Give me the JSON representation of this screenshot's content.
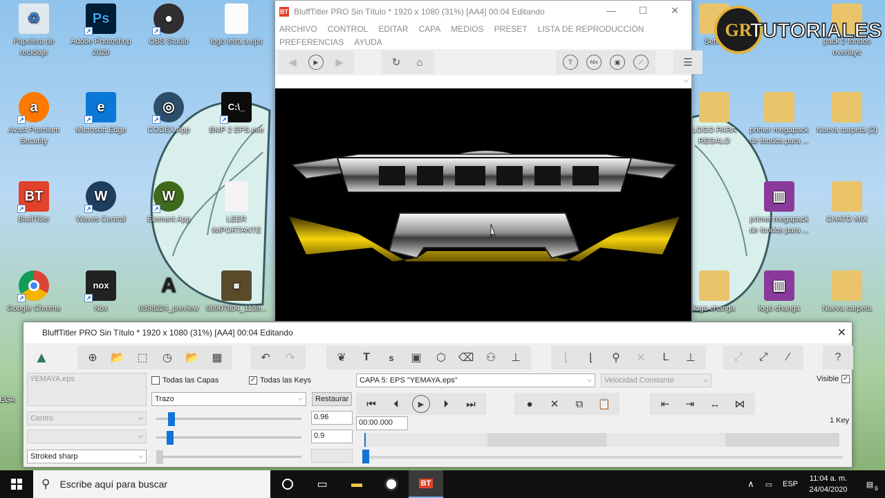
{
  "desktop": {
    "icons": [
      {
        "label": "Papelera de reciclaje",
        "x": 1
      },
      {
        "label": "Adobe Photoshop 2020"
      },
      {
        "label": "OBS Studio"
      },
      {
        "label": "logo letra a.eps"
      },
      {
        "label": "Avast Premium Security"
      },
      {
        "label": "Microsoft Edge"
      },
      {
        "label": "CODEX App"
      },
      {
        "label": "BMP 2 EPS.exe"
      },
      {
        "label": "BluffTitler"
      },
      {
        "label": "Waves Central"
      },
      {
        "label": "Element App"
      },
      {
        "label": "LEER IMPORTANTE"
      },
      {
        "label": "Google Chrome"
      },
      {
        "label": "Nox"
      },
      {
        "label": "6398224_preview"
      },
      {
        "label": "08907804_1138..."
      },
      {
        "label": "Sett..."
      },
      {
        "label": "pack 2 fondos overlays"
      },
      {
        "label": "LOGO PARA REGALO"
      },
      {
        "label": "primer megapack de fondos para ..."
      },
      {
        "label": "Nueva carpeta (2)"
      },
      {
        "label": "primer megapack de fondos para ..."
      },
      {
        "label": "CHATO MIX"
      },
      {
        "label": "logo changa"
      },
      {
        "label": "logo changa"
      },
      {
        "label": "Nueva carpeta"
      },
      {
        "label": "VEGA"
      }
    ],
    "icon_badges": {
      "photoshop": "Ps",
      "bluff": "BT",
      "cmd": "C:\\_",
      "nox": "nox"
    }
  },
  "watermark": {
    "text": "TUTORIALES",
    "monogram": "GR"
  },
  "top_window": {
    "title": "BluffTitler PRO   Sin Título * 1920 x 1080 (31%) [AA4] 00:04 Editando",
    "menu": [
      "ARCHIVO",
      "CONTROL",
      "EDITAR",
      "CAPA",
      "MEDIOS",
      "PRESET",
      "LISTA DE REPRODUCCIÓN",
      "PREFERENCIAS",
      "AYUDA"
    ],
    "tool_text_icons": [
      "T",
      "Abc"
    ],
    "app_logo": "BT"
  },
  "bottom_window": {
    "title": "BluffTitler PRO   Sin Título * 1920 x 1080 (31%) [AA4] 00:04 Editando",
    "tool_letters": {
      "text": "T",
      "s": "s"
    },
    "layer_name": "YEMAYA.eps",
    "all_layers_label": "Todas las Capas",
    "all_layers_checked": false,
    "all_keys_label": "Todas las Keys",
    "all_keys_checked": true,
    "trazo_select": "Trazo",
    "restore_button": "Restaurar",
    "centro_select": "Centro",
    "empty_select": "",
    "stroked_select": "Stroked sharp",
    "value_1": "0.96",
    "value_2": "0.9",
    "layer_select": "CAPA    5: EPS \"YEMAYA.eps\"",
    "speed_select": "Velocidad Constante",
    "visible_label": "Visible",
    "visible_checked": true,
    "time_value": "00:00.000",
    "key_count": "1 Key",
    "slider_1": 0.08,
    "slider_2": 0.07
  },
  "taskbar": {
    "search_placeholder": "Escribe aquí para buscar",
    "language": "ESP",
    "time": "11:04 a. m.",
    "date": "24/04/2020",
    "notification_count": "6",
    "active_app_badge": "BT"
  },
  "colors": {
    "accent": "#1273d6",
    "bluff_red": "#e2412b",
    "logo_gold": "#e0b23a"
  }
}
